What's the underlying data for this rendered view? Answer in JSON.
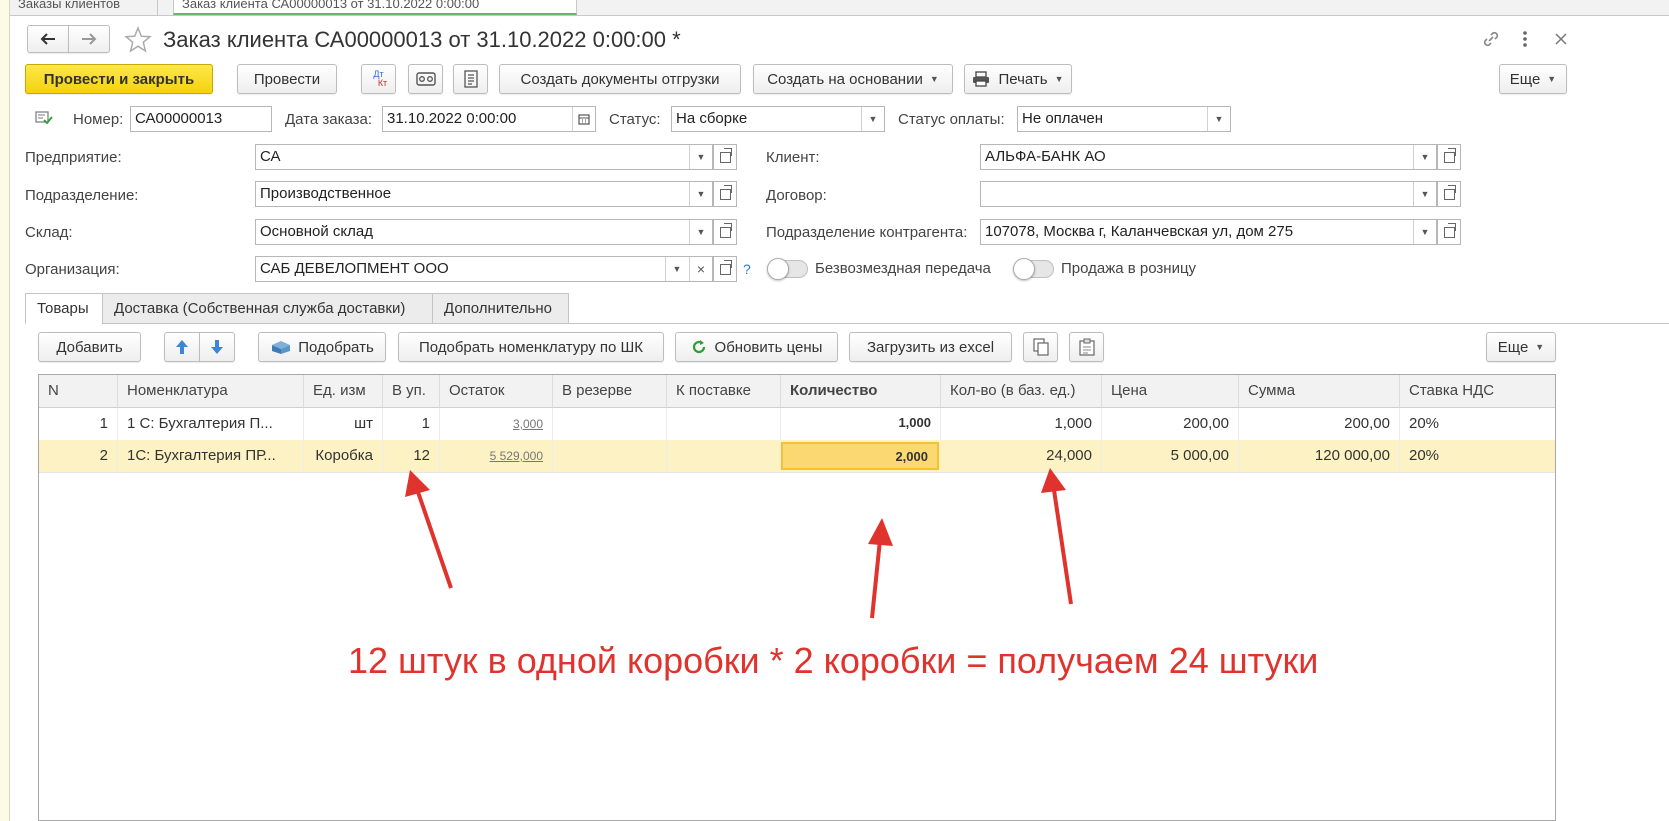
{
  "tabs": {
    "tab1": "Заказы клиентов",
    "tab2": "Заказ клиента СА00000013 от 31.10.2022 0:00:00"
  },
  "window": {
    "title": "Заказ клиента СА00000013 от 31.10.2022 0:00:00 *"
  },
  "toolbar": {
    "post_close": "Провести и закрыть",
    "post": "Провести",
    "dt_kt_top": "Дт",
    "dt_kt_bottom": "Кт",
    "create_shipment": "Создать документы отгрузки",
    "create_based": "Создать на основании",
    "print": "Печать",
    "more": "Еще"
  },
  "header": {
    "number_label": "Номер:",
    "number_value": "СА00000013",
    "date_label": "Дата заказа:",
    "date_value": "31.10.2022  0:00:00",
    "status_label": "Статус:",
    "status_value": "На сборке",
    "pay_status_label": "Статус оплаты:",
    "pay_status_value": "Не оплачен"
  },
  "form": {
    "enterprise_label": "Предприятие:",
    "enterprise_value": "СА",
    "division_label": "Подразделение:",
    "division_value": "Производственное",
    "warehouse_label": "Склад:",
    "warehouse_value": "Основной склад",
    "org_label": "Организация:",
    "org_value": "САБ ДЕВЕЛОПМЕНТ ООО",
    "help": "?",
    "client_label": "Клиент:",
    "client_value": "АЛЬФА-БАНК АО",
    "contract_label": "Договор:",
    "contract_value": "",
    "cp_division_label": "Подразделение контрагента:",
    "cp_division_value": "107078, Москва г, Каланчевская ул, дом 275",
    "free_transfer_label": "Безвозмездная передача",
    "retail_label": "Продажа в розницу"
  },
  "doc_tabs": [
    "Товары",
    "Доставка (Собственная служба доставки)",
    "Дополнительно"
  ],
  "goods_toolbar": {
    "add": "Добавить",
    "pick": "Подобрать",
    "pick_barcode": "Подобрать номенклатуру по ШК",
    "update_prices": "Обновить цены",
    "load_excel": "Загрузить из excel",
    "more": "Еще"
  },
  "table": {
    "columns": [
      "N",
      "Номенклатура",
      "Ед. изм",
      "В уп.",
      "Остаток",
      "В резерве",
      "К поставке",
      "Количество",
      "Кол-во (в баз. ед.)",
      "Цена",
      "Сумма",
      "Ставка НДС"
    ],
    "rows": [
      {
        "n": "1",
        "item": "1 С:  Бухгалтерия П...",
        "unit": "шт",
        "per_pack": "1",
        "stock": "3,000",
        "reserve": "",
        "to_deliver": "",
        "qty": "1,000",
        "qty_base": "1,000",
        "price": "200,00",
        "sum": "200,00",
        "vat": "20%"
      },
      {
        "n": "2",
        "item": "1С: Бухгалтерия ПР...",
        "unit": "Коробка",
        "per_pack": "12",
        "stock": "5 529,000",
        "reserve": "",
        "to_deliver": "",
        "qty": "2,000",
        "qty_base": "24,000",
        "price": "5 000,00",
        "sum": "120 000,00",
        "vat": "20%"
      }
    ]
  },
  "annotation": "12 штук в одной коробки * 2 коробки = получаем 24 штуки",
  "colors": {
    "accent_yellow": "#f4d20c",
    "selected_row": "#fdf2c4",
    "annotation_red": "#e0332d"
  }
}
